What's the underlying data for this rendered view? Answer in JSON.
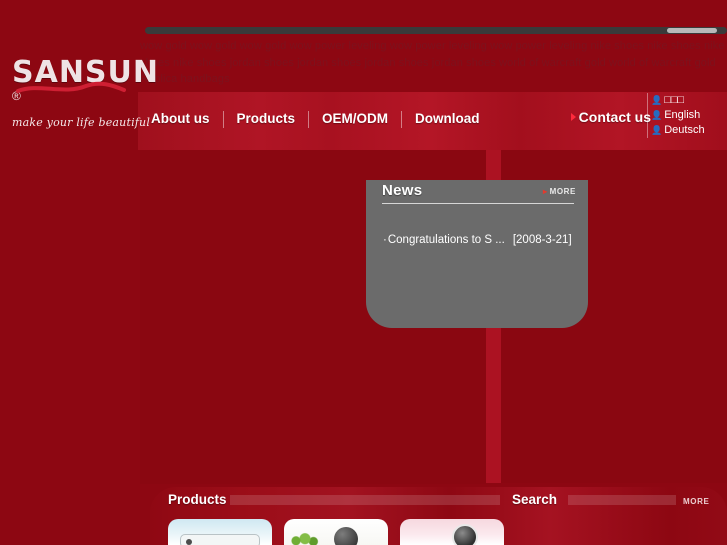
{
  "site": {
    "brand_name": "SANSUN",
    "brand_mark": "®",
    "tagline": "make your life beautiful",
    "accent_red": "#a50d1a",
    "dark_red": "#8a0711",
    "panel_gray": "#6b6b6b"
  },
  "keyword_text": "wow gold wow gold wow gold wow power leveling wow power leveling wow power leveling nike shoes nike shoes nike shoes nike shoes jordan shoes jordan shoes jordan shoes jordan shoes world of warcraft gold world of warcraft gold Replica handbags",
  "nav": {
    "items": [
      {
        "label": "About us"
      },
      {
        "label": "Products"
      },
      {
        "label": "OEM/ODM"
      },
      {
        "label": "Download"
      }
    ],
    "contact_label": "Contact us"
  },
  "languages": [
    {
      "label": "□□□"
    },
    {
      "label": "English"
    },
    {
      "label": "Deutsch"
    }
  ],
  "news": {
    "title": "News",
    "more_label": "MORE",
    "items": [
      {
        "bullet": "·",
        "title": "Congratulations to S ...",
        "date": "[2008-3-21]"
      }
    ]
  },
  "bottom": {
    "products_label": "Products",
    "search_label": "Search",
    "more_label": "MORE"
  }
}
